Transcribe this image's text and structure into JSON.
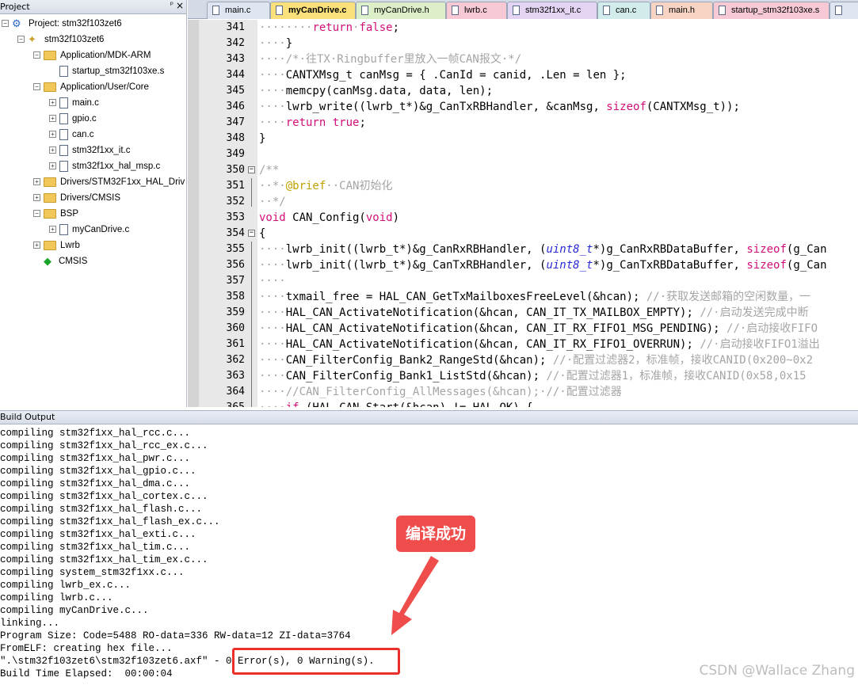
{
  "project": {
    "header_title": "Project",
    "pin_glyph": "ᵖ",
    "close_glyph": "×",
    "tree": [
      {
        "label": "Project: stm32f103zet6",
        "icon": "project-icon",
        "expander": "−"
      },
      {
        "label": "stm32f103zet6",
        "icon": "target-icon",
        "expander": "−"
      },
      {
        "label": "Application/MDK-ARM",
        "icon": "folder-icon",
        "expander": "−"
      },
      {
        "label": "startup_stm32f103xe.s",
        "icon": "file-icon",
        "expander": ""
      },
      {
        "label": "Application/User/Core",
        "icon": "folder-icon",
        "expander": "−"
      },
      {
        "label": "main.c",
        "icon": "file-icon",
        "expander": "+"
      },
      {
        "label": "gpio.c",
        "icon": "file-icon",
        "expander": "+"
      },
      {
        "label": "can.c",
        "icon": "file-icon",
        "expander": "+"
      },
      {
        "label": "stm32f1xx_it.c",
        "icon": "file-icon",
        "expander": "+"
      },
      {
        "label": "stm32f1xx_hal_msp.c",
        "icon": "file-icon",
        "expander": "+"
      },
      {
        "label": "Drivers/STM32F1xx_HAL_Driv",
        "icon": "folder-icon",
        "expander": "+"
      },
      {
        "label": "Drivers/CMSIS",
        "icon": "folder-icon",
        "expander": "+"
      },
      {
        "label": "BSP",
        "icon": "folder-icon",
        "expander": "−"
      },
      {
        "label": "myCanDrive.c",
        "icon": "file-icon",
        "expander": "+"
      },
      {
        "label": "Lwrb",
        "icon": "folder-icon",
        "expander": "+"
      },
      {
        "label": "CMSIS",
        "icon": "cmsis-gem-icon",
        "expander": ""
      }
    ]
  },
  "tabs": [
    {
      "label": "main.c",
      "color": "#dfe6f2"
    },
    {
      "label": "myCanDrive.c",
      "color": "#f9e07a"
    },
    {
      "label": "myCanDrive.h",
      "color": "#dcefc8"
    },
    {
      "label": "lwrb.c",
      "color": "#f6c9d4"
    },
    {
      "label": "stm32f1xx_it.c",
      "color": "#e2d4f2"
    },
    {
      "label": "can.c",
      "color": "#d2ecec"
    },
    {
      "label": "main.h",
      "color": "#f7d3c3"
    },
    {
      "label": "startup_stm32f103xe.s",
      "color": "#f6c9d4"
    },
    {
      "label": "",
      "color": "#dfe6f2"
    }
  ],
  "editor": {
    "lines": [
      {
        "n": "341",
        "fold": ""
      },
      {
        "n": "342",
        "fold": ""
      },
      {
        "n": "343",
        "fold": ""
      },
      {
        "n": "344",
        "fold": ""
      },
      {
        "n": "345",
        "fold": ""
      },
      {
        "n": "346",
        "fold": ""
      },
      {
        "n": "347",
        "fold": ""
      },
      {
        "n": "348",
        "fold": ""
      },
      {
        "n": "349",
        "fold": ""
      },
      {
        "n": "350",
        "fold": "−"
      },
      {
        "n": "351",
        "fold": ""
      },
      {
        "n": "352",
        "fold": ""
      },
      {
        "n": "353",
        "fold": ""
      },
      {
        "n": "354",
        "fold": "−"
      },
      {
        "n": "355",
        "fold": ""
      },
      {
        "n": "356",
        "fold": ""
      },
      {
        "n": "357",
        "fold": ""
      },
      {
        "n": "358",
        "fold": ""
      },
      {
        "n": "359",
        "fold": ""
      },
      {
        "n": "360",
        "fold": ""
      },
      {
        "n": "361",
        "fold": ""
      },
      {
        "n": "362",
        "fold": ""
      },
      {
        "n": "363",
        "fold": ""
      },
      {
        "n": "364",
        "fold": ""
      },
      {
        "n": "365",
        "fold": ""
      }
    ],
    "code": [
      [
        {
          "t": "········",
          "c": "dl"
        },
        {
          "t": "return",
          "c": "kw"
        },
        {
          "t": "·",
          "c": "dl"
        },
        {
          "t": "false",
          "c": "kw"
        },
        {
          "t": ";",
          "c": ""
        }
      ],
      [
        {
          "t": "····",
          "c": "dl"
        },
        {
          "t": "}",
          "c": ""
        }
      ],
      [
        {
          "t": "····",
          "c": "dl"
        },
        {
          "t": "/*·往TX·Ringbuffer里放入一帧CAN报文·*/",
          "c": "cm"
        }
      ],
      [
        {
          "t": "····",
          "c": "dl"
        },
        {
          "t": "CANTXMsg_t canMsg = { .CanId = canid, .Len = len };",
          "c": ""
        }
      ],
      [
        {
          "t": "····",
          "c": "dl"
        },
        {
          "t": "memcpy(canMsg.data, data, len);",
          "c": ""
        }
      ],
      [
        {
          "t": "····",
          "c": "dl"
        },
        {
          "t": "lwrb_write((lwrb_t*)&g_CanTxRBHandler, &canMsg, ",
          "c": ""
        },
        {
          "t": "sizeof",
          "c": "kw"
        },
        {
          "t": "(CANTXMsg_t));",
          "c": ""
        }
      ],
      [
        {
          "t": "····",
          "c": "dl"
        },
        {
          "t": "return",
          "c": "kw"
        },
        {
          "t": " ",
          "c": ""
        },
        {
          "t": "true",
          "c": "kw"
        },
        {
          "t": ";",
          "c": ""
        }
      ],
      [
        {
          "t": "}",
          "c": ""
        }
      ],
      [
        {
          "t": "",
          "c": ""
        }
      ],
      [
        {
          "t": "/**",
          "c": "cm"
        }
      ],
      [
        {
          "t": "··*·",
          "c": "cm"
        },
        {
          "t": "@brief",
          "c": "dox"
        },
        {
          "t": "··CAN初始化",
          "c": "cm"
        }
      ],
      [
        {
          "t": "··*/",
          "c": "cm"
        }
      ],
      [
        {
          "t": "void",
          "c": "kw"
        },
        {
          "t": " CAN_Config(",
          "c": ""
        },
        {
          "t": "void",
          "c": "kw"
        },
        {
          "t": ")",
          "c": ""
        }
      ],
      [
        {
          "t": "{",
          "c": ""
        }
      ],
      [
        {
          "t": "····",
          "c": "dl"
        },
        {
          "t": "lwrb_init((lwrb_t*)&g_CanRxRBHandler, (",
          "c": ""
        },
        {
          "t": "uint8_t",
          "c": "ty"
        },
        {
          "t": "*)g_CanRxRBDataBuffer, ",
          "c": ""
        },
        {
          "t": "sizeof",
          "c": "kw"
        },
        {
          "t": "(g_Can",
          "c": ""
        }
      ],
      [
        {
          "t": "····",
          "c": "dl"
        },
        {
          "t": "lwrb_init((lwrb_t*)&g_CanTxRBHandler, (",
          "c": ""
        },
        {
          "t": "uint8_t",
          "c": "ty"
        },
        {
          "t": "*)g_CanTxRBDataBuffer, ",
          "c": ""
        },
        {
          "t": "sizeof",
          "c": "kw"
        },
        {
          "t": "(g_Can",
          "c": ""
        }
      ],
      [
        {
          "t": "····",
          "c": "dl"
        }
      ],
      [
        {
          "t": "····",
          "c": "dl"
        },
        {
          "t": "txmail_free = HAL_CAN_GetTxMailboxesFreeLevel(&hcan); ",
          "c": ""
        },
        {
          "t": "//·获取发送邮箱的空闲数量，一",
          "c": "cm"
        }
      ],
      [
        {
          "t": "····",
          "c": "dl"
        },
        {
          "t": "HAL_CAN_ActivateNotification(&hcan, CAN_IT_TX_MAILBOX_EMPTY); ",
          "c": ""
        },
        {
          "t": "//·启动发送完成中断",
          "c": "cm"
        }
      ],
      [
        {
          "t": "····",
          "c": "dl"
        },
        {
          "t": "HAL_CAN_ActivateNotification(&hcan, CAN_IT_RX_FIFO1_MSG_PENDING); ",
          "c": ""
        },
        {
          "t": "//·启动接收FIFO",
          "c": "cm"
        }
      ],
      [
        {
          "t": "····",
          "c": "dl"
        },
        {
          "t": "HAL_CAN_ActivateNotification(&hcan, CAN_IT_RX_FIFO1_OVERRUN); ",
          "c": ""
        },
        {
          "t": "//·启动接收FIFO1溢出",
          "c": "cm"
        }
      ],
      [
        {
          "t": "····",
          "c": "dl"
        },
        {
          "t": "CAN_FilterConfig_Bank2_RangeStd(&hcan); ",
          "c": ""
        },
        {
          "t": "//·配置过滤器2，标准帧，接收CANID(0x200~0x2",
          "c": "cm"
        }
      ],
      [
        {
          "t": "····",
          "c": "dl"
        },
        {
          "t": "CAN_FilterConfig_Bank1_ListStd(&hcan); ",
          "c": ""
        },
        {
          "t": "//·配置过滤器1，标准帧，接收CANID(0x58,0x15",
          "c": "cm"
        }
      ],
      [
        {
          "t": "····",
          "c": "dl"
        },
        {
          "t": "//CAN_FilterConfig_AllMessages(&hcan);·//·配置过滤器",
          "c": "cm"
        }
      ],
      [
        {
          "t": "····",
          "c": "dl"
        },
        {
          "t": "if",
          "c": "kw"
        },
        {
          "t": " (HAL_CAN_Start(&hcan) != HAL_OK) {",
          "c": ""
        }
      ]
    ]
  },
  "build": {
    "header_title": "Build Output",
    "lines": [
      "compiling stm32f1xx_hal_rcc.c...",
      "compiling stm32f1xx_hal_rcc_ex.c...",
      "compiling stm32f1xx_hal_pwr.c...",
      "compiling stm32f1xx_hal_gpio.c...",
      "compiling stm32f1xx_hal_dma.c...",
      "compiling stm32f1xx_hal_cortex.c...",
      "compiling stm32f1xx_hal_flash.c...",
      "compiling stm32f1xx_hal_flash_ex.c...",
      "compiling stm32f1xx_hal_exti.c...",
      "compiling stm32f1xx_hal_tim.c...",
      "compiling stm32f1xx_hal_tim_ex.c...",
      "compiling system_stm32f1xx.c...",
      "compiling lwrb_ex.c...",
      "compiling lwrb.c...",
      "compiling myCanDrive.c...",
      "linking...",
      "Program Size: Code=5488 RO-data=336 RW-data=12 ZI-data=3764",
      "FromELF: creating hex file...",
      "\".\\stm32f103zet6\\stm32f103zet6.axf\" - 0 Error(s), 0 Warning(s).",
      "Build Time Elapsed:  00:00:04"
    ]
  },
  "annotation": {
    "label": "编译成功",
    "color": "#ef4d4b"
  },
  "watermark": "CSDN @Wallace Zhang"
}
